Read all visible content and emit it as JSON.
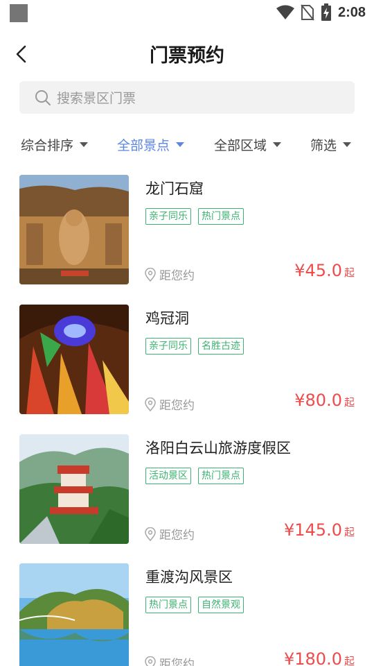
{
  "status_bar": {
    "time": "2:08"
  },
  "header": {
    "title": "门票预约"
  },
  "search": {
    "placeholder": "搜索景区门票"
  },
  "filters": [
    {
      "label": "综合排序",
      "active": false
    },
    {
      "label": "全部景点",
      "active": true
    },
    {
      "label": "全部区域",
      "active": false
    },
    {
      "label": "筛选",
      "active": false
    }
  ],
  "distance_label": "距您约",
  "price_unit": "起",
  "items": [
    {
      "name": "龙门石窟",
      "tags": [
        "亲子同乐",
        "热门景点"
      ],
      "price": "¥45.0"
    },
    {
      "name": "鸡冠洞",
      "tags": [
        "亲子同乐",
        "名胜古迹"
      ],
      "price": "¥80.0"
    },
    {
      "name": "洛阳白云山旅游度假区",
      "tags": [
        "活动景区",
        "热门景点"
      ],
      "price": "¥145.0"
    },
    {
      "name": "重渡沟风景区",
      "tags": [
        "热门景点",
        "自然景观"
      ],
      "price": "¥180.0"
    }
  ],
  "colors": {
    "accent": "#5b86e5",
    "tag": "#3cb371",
    "price": "#ee4b4b"
  }
}
